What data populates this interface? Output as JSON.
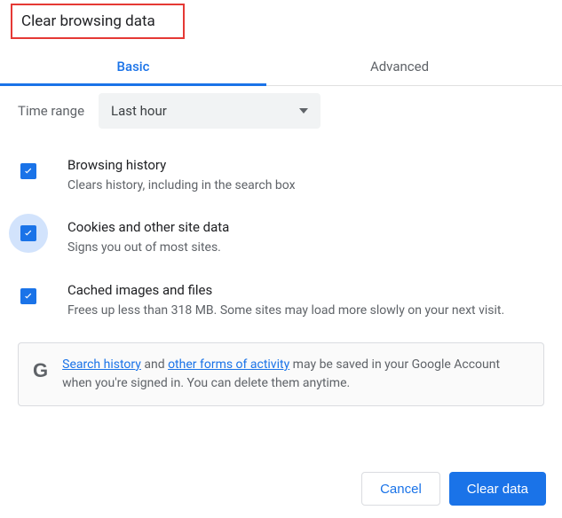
{
  "title": "Clear browsing data",
  "tabs": {
    "basic": "Basic",
    "advanced": "Advanced"
  },
  "time": {
    "label": "Time range",
    "selected": "Last hour"
  },
  "options": {
    "history": {
      "title": "Browsing history",
      "desc": "Clears history, including in the search box"
    },
    "cookies": {
      "title": "Cookies and other site data",
      "desc": "Signs you out of most sites."
    },
    "cache": {
      "title": "Cached images and files",
      "desc": "Frees up less than 318 MB. Some sites may load more slowly on your next visit."
    }
  },
  "notice": {
    "link1": "Search history",
    "mid1": " and ",
    "link2": "other forms of activity",
    "tail": " may be saved in your Google Account when you're signed in. You can delete them anytime."
  },
  "buttons": {
    "cancel": "Cancel",
    "clear": "Clear data"
  }
}
